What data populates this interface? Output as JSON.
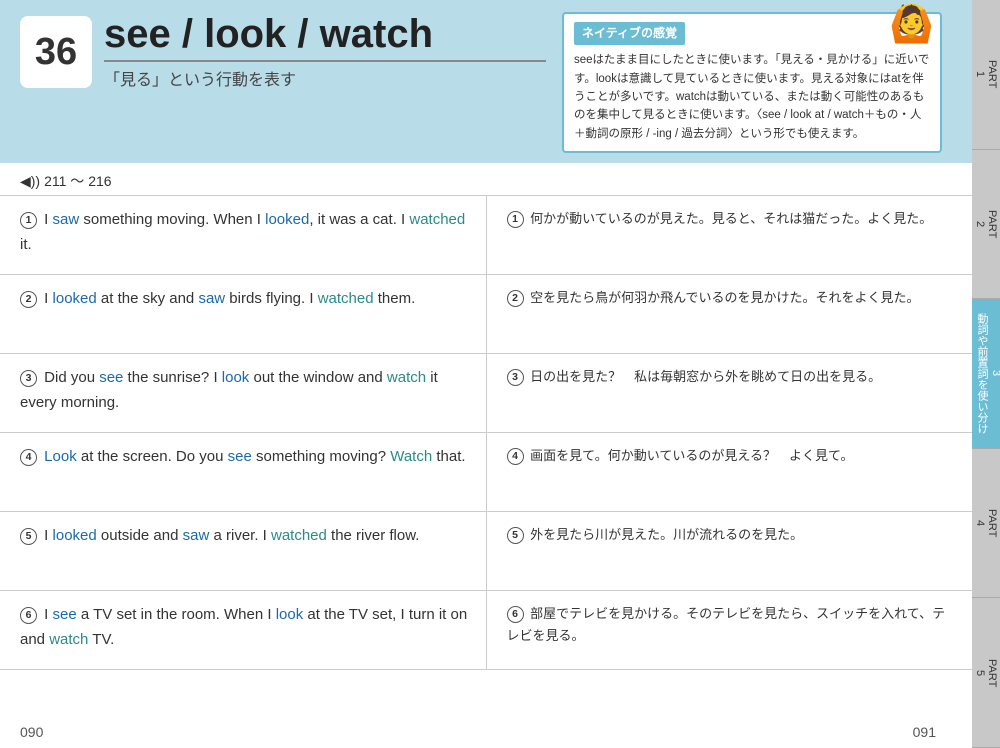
{
  "header": {
    "lesson_number": "36",
    "title": "see / look / watch",
    "subtitle": "「見る」という行動を表す",
    "native_box_title": "ネイティブの感覚",
    "native_box_text": "seeはたまま目にしたときに使います。「見える・見かける」に近いです。lookは意識して見ているときに使います。見える対象にはatを伴うことが多いです。watchは動いている、または動く可能性のあるものを集中して見るときに使います。〈see / look at / watch＋もの・人＋動詞の原形 / -ing / 過去分詞〉という形でも使えます。",
    "audio_label": "◀)) 211 ～ 216"
  },
  "sentences": [
    {
      "id": 1,
      "english_parts": [
        {
          "text": "I ",
          "type": "normal"
        },
        {
          "text": "saw",
          "type": "blue"
        },
        {
          "text": " something moving. When I ",
          "type": "normal"
        },
        {
          "text": "looked",
          "type": "blue"
        },
        {
          "text": ", it was a cat. I ",
          "type": "normal"
        },
        {
          "text": "watched",
          "type": "teal"
        },
        {
          "text": " it.",
          "type": "normal"
        }
      ],
      "japanese": "何かが動いているのが見えた。見ると、それは猫だった。よく見た。"
    },
    {
      "id": 2,
      "english_parts": [
        {
          "text": "I ",
          "type": "normal"
        },
        {
          "text": "looked",
          "type": "blue"
        },
        {
          "text": " at the sky and ",
          "type": "normal"
        },
        {
          "text": "saw",
          "type": "blue"
        },
        {
          "text": " birds flying. I ",
          "type": "normal"
        },
        {
          "text": "watched",
          "type": "teal"
        },
        {
          "text": " them.",
          "type": "normal"
        }
      ],
      "japanese": "空を見たら鳥が何羽か飛んでいるのを見かけた。それをよく見た。"
    },
    {
      "id": 3,
      "english_parts": [
        {
          "text": "Did you ",
          "type": "normal"
        },
        {
          "text": "see",
          "type": "blue"
        },
        {
          "text": " the sunrise? I ",
          "type": "normal"
        },
        {
          "text": "look",
          "type": "blue"
        },
        {
          "text": " out the window and ",
          "type": "normal"
        },
        {
          "text": "watch",
          "type": "teal"
        },
        {
          "text": " it every morning.",
          "type": "normal"
        }
      ],
      "japanese": "日の出を見た？　私は毎朝窓から外を眺めて日の出を見る。"
    },
    {
      "id": 4,
      "english_parts": [
        {
          "text": "Look",
          "type": "blue"
        },
        {
          "text": " at the screen. Do you ",
          "type": "normal"
        },
        {
          "text": "see",
          "type": "blue"
        },
        {
          "text": " something moving? ",
          "type": "normal"
        },
        {
          "text": "Watch",
          "type": "teal"
        },
        {
          "text": " that.",
          "type": "normal"
        }
      ],
      "japanese": "画面を見て。何か動いているのが見える？　よく見て。"
    },
    {
      "id": 5,
      "english_parts": [
        {
          "text": "I ",
          "type": "normal"
        },
        {
          "text": "looked",
          "type": "blue"
        },
        {
          "text": " outside and ",
          "type": "normal"
        },
        {
          "text": "saw",
          "type": "blue"
        },
        {
          "text": " a river. I ",
          "type": "normal"
        },
        {
          "text": "watched",
          "type": "teal"
        },
        {
          "text": " the river flow.",
          "type": "normal"
        }
      ],
      "japanese": "外を見たら川が見えた。川が流れるのを見た。"
    },
    {
      "id": 6,
      "english_parts": [
        {
          "text": "I ",
          "type": "normal"
        },
        {
          "text": "see",
          "type": "blue"
        },
        {
          "text": " a TV set in the room. When I ",
          "type": "normal"
        },
        {
          "text": "look",
          "type": "blue"
        },
        {
          "text": " at the TV set, I turn it on and ",
          "type": "normal"
        },
        {
          "text": "watch",
          "type": "teal"
        },
        {
          "text": " TV.",
          "type": "normal"
        }
      ],
      "japanese": "部屋でテレビを見かける。そのテレビを見たら、スイッチを入れて、テレビを見る。"
    }
  ],
  "side_tabs": [
    {
      "label": "PART\n1",
      "active": false
    },
    {
      "label": "PART\n2",
      "active": false
    },
    {
      "label": "PART\n3\n動詞や前置詞を使い分ける",
      "active": true
    },
    {
      "label": "PART\n4",
      "active": false
    },
    {
      "label": "PART\n5",
      "active": false
    }
  ],
  "footer": {
    "left_page": "090",
    "right_page": "091"
  }
}
